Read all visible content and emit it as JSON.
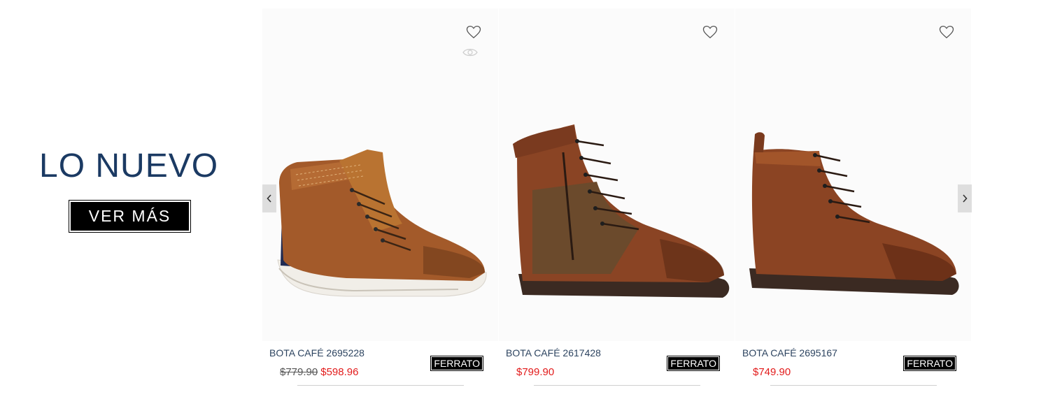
{
  "promo": {
    "title": "LO NUEVO",
    "button_label": "VER MÁS"
  },
  "products": [
    {
      "name": "BOTA CAFÉ 2695228",
      "old_price": "$779.90",
      "price": "$598.96",
      "brand": "FERRATO"
    },
    {
      "name": "BOTA CAFÉ 2617428",
      "old_price": "",
      "price": "$799.90",
      "brand": "FERRATO"
    },
    {
      "name": "BOTA CAFÉ 2695167",
      "old_price": "",
      "price": "$749.90",
      "brand": "FERRATO"
    }
  ],
  "icons": {
    "favorite": "heart-icon",
    "quick_view": "eye-icon",
    "prev": "chevron-left-icon",
    "next": "chevron-right-icon"
  },
  "colors": {
    "title": "#1b3a63",
    "sale_price": "#e21b1b",
    "button_bg": "#000000",
    "brand_bg": "#000000"
  }
}
